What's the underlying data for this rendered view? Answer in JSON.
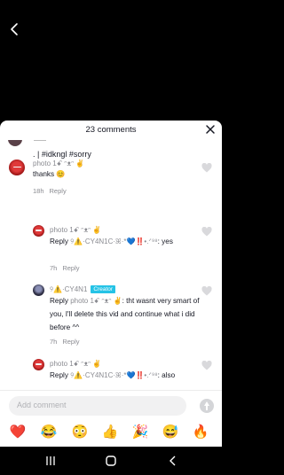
{
  "header": {
    "comment_count": "23 comments"
  },
  "caption": {
    "text": ". | #idkngl #sorry"
  },
  "comments": [
    {
      "username": "photo 1ꗃ ᵔᴥᵔ ✌️",
      "text": "thanks 😊",
      "age": "18h",
      "reply": "Reply"
    },
    {
      "username": "photo 1ꗃ ᵔᴥᵔ ✌️",
      "reply_prefix": "Reply ",
      "reply_to": "୨⚠️·CY4N1C·ꕤ·*💙‼️•.ᐟ⁹⁸",
      "text": ": yes",
      "age": "7h",
      "reply": "Reply"
    },
    {
      "username": "୨⚠️·CY4N1",
      "badge": "Creator",
      "reply_prefix": "Reply ",
      "reply_to": "photo 1ꗃ ᵔᴥᵔ ✌️",
      "text": ": tht wasnt very smart of you, I'll delete this vid and continue what i did before ^^",
      "age": "7h",
      "reply": "Reply"
    },
    {
      "username": "photo 1ꗃ ᵔᴥᵔ ✌️",
      "reply_prefix": "Reply ",
      "reply_to": "୨⚠️·CY4N1C·ꕤ·*💙‼️•.ᐟ⁹⁸",
      "text": ": also"
    }
  ],
  "input": {
    "placeholder": "Add comment"
  },
  "emojis": [
    {
      "name": "heart",
      "glyph": "❤️"
    },
    {
      "name": "tears-of-joy",
      "glyph": "😂"
    },
    {
      "name": "flushed",
      "glyph": "😳"
    },
    {
      "name": "thumbs-up",
      "glyph": "👍"
    },
    {
      "name": "party-popper",
      "glyph": "🎉"
    },
    {
      "name": "grinning-sweat",
      "glyph": "😅"
    },
    {
      "name": "fire",
      "glyph": "🔥"
    }
  ],
  "colors": {
    "creator_badge": "#25c3e6",
    "muted_text": "#8a8b91",
    "sheet_bg": "#ffffff"
  }
}
